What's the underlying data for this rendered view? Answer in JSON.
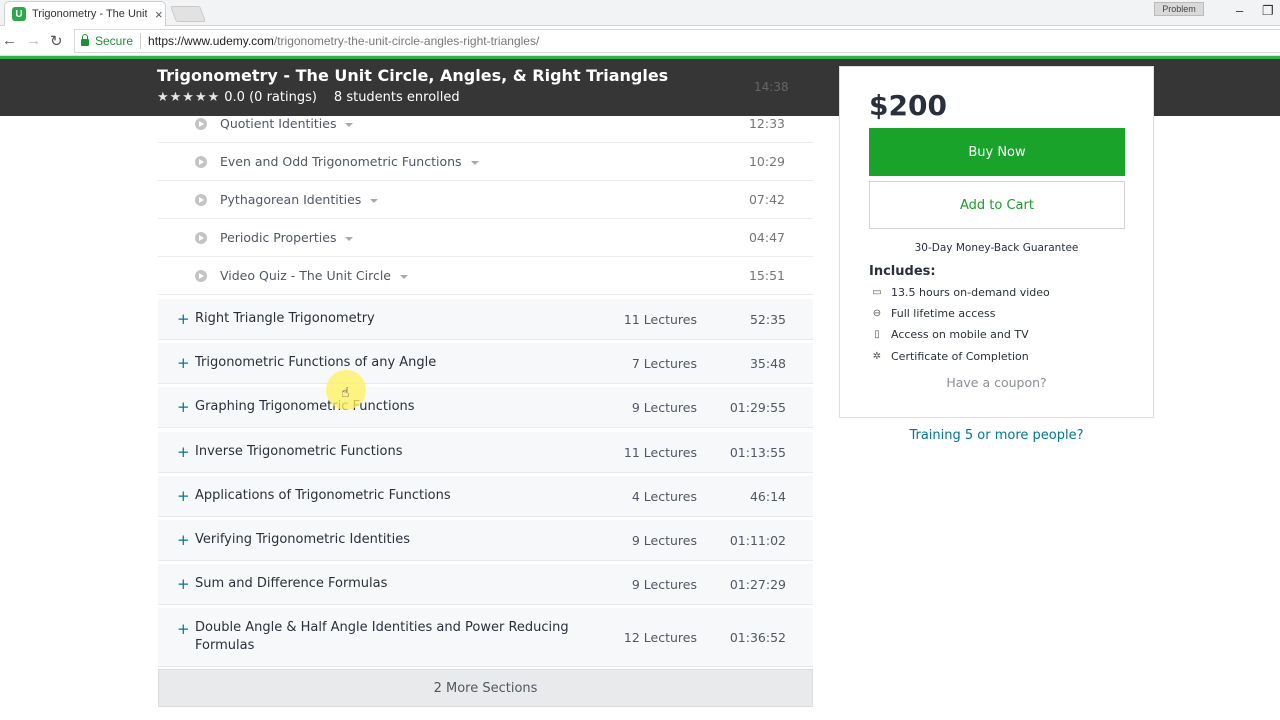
{
  "browser": {
    "tab_title": "Trigonometry - The Unit",
    "favicon_letter": "U",
    "tab_close": "×",
    "profile_label": "Problem",
    "minimize": "–",
    "maximize": "❐",
    "back": "←",
    "forward": "→",
    "reload": "↻",
    "secure_label": "Secure",
    "url_host": "https://www.udemy.com",
    "url_path": "/trigonometry-the-unit-circle-angles-right-triangles/"
  },
  "header": {
    "title": "Trigonometry - The Unit Circle, Angles, & Right Triangles",
    "stars": "★★★★★",
    "rating_text": "0.0 (0 ratings)",
    "enrolled": "8 students enrolled",
    "ghost_time": "14:38"
  },
  "lectures": [
    {
      "title": "Quotient Identities",
      "time": "12:33"
    },
    {
      "title": "Even and Odd Trigonometric Functions",
      "time": "10:29"
    },
    {
      "title": "Pythagorean Identities",
      "time": "07:42"
    },
    {
      "title": "Periodic Properties",
      "time": "04:47"
    },
    {
      "title": "Video Quiz - The Unit Circle",
      "time": "15:51"
    }
  ],
  "sections": [
    {
      "title": "Right Triangle Trigonometry",
      "lectures": "11 Lectures",
      "time": "52:35"
    },
    {
      "title": "Trigonometric Functions of any Angle",
      "lectures": "7 Lectures",
      "time": "35:48"
    },
    {
      "title": "Graphing Trigonometric Functions",
      "lectures": "9 Lectures",
      "time": "01:29:55"
    },
    {
      "title": "Inverse Trigonometric Functions",
      "lectures": "11 Lectures",
      "time": "01:13:55"
    },
    {
      "title": "Applications of Trigonometric Functions",
      "lectures": "4 Lectures",
      "time": "46:14"
    },
    {
      "title": "Verifying Trigonometric Identities",
      "lectures": "9 Lectures",
      "time": "01:11:02"
    },
    {
      "title": "Sum and Difference Formulas",
      "lectures": "9 Lectures",
      "time": "01:27:29"
    },
    {
      "title": "Double Angle & Half Angle Identities and Power Reducing Formulas",
      "lectures": "12 Lectures",
      "time": "01:36:52"
    }
  ],
  "section_toggle_symbol": "+",
  "more_sections": "2 More Sections",
  "sidebar": {
    "price": "$200",
    "buy_now": "Buy Now",
    "add_to_cart": "Add to Cart",
    "guarantee": "30-Day Money-Back Guarantee",
    "includes_title": "Includes:",
    "includes": [
      {
        "icon": "video-icon",
        "glyph": "▭",
        "text": "13.5 hours on-demand video"
      },
      {
        "icon": "infinity-icon",
        "glyph": "⊖",
        "text": "Full lifetime access"
      },
      {
        "icon": "mobile-icon",
        "glyph": "▯",
        "text": "Access on mobile and TV"
      },
      {
        "icon": "certificate-icon",
        "glyph": "✲",
        "text": "Certificate of Completion"
      }
    ],
    "coupon": "Have a coupon?",
    "training": "Training 5 or more people?"
  },
  "colors": {
    "buy_green": "#1aa32a",
    "link_teal": "#007791",
    "header_dark": "#292929",
    "accent_line": "#2db34a"
  }
}
